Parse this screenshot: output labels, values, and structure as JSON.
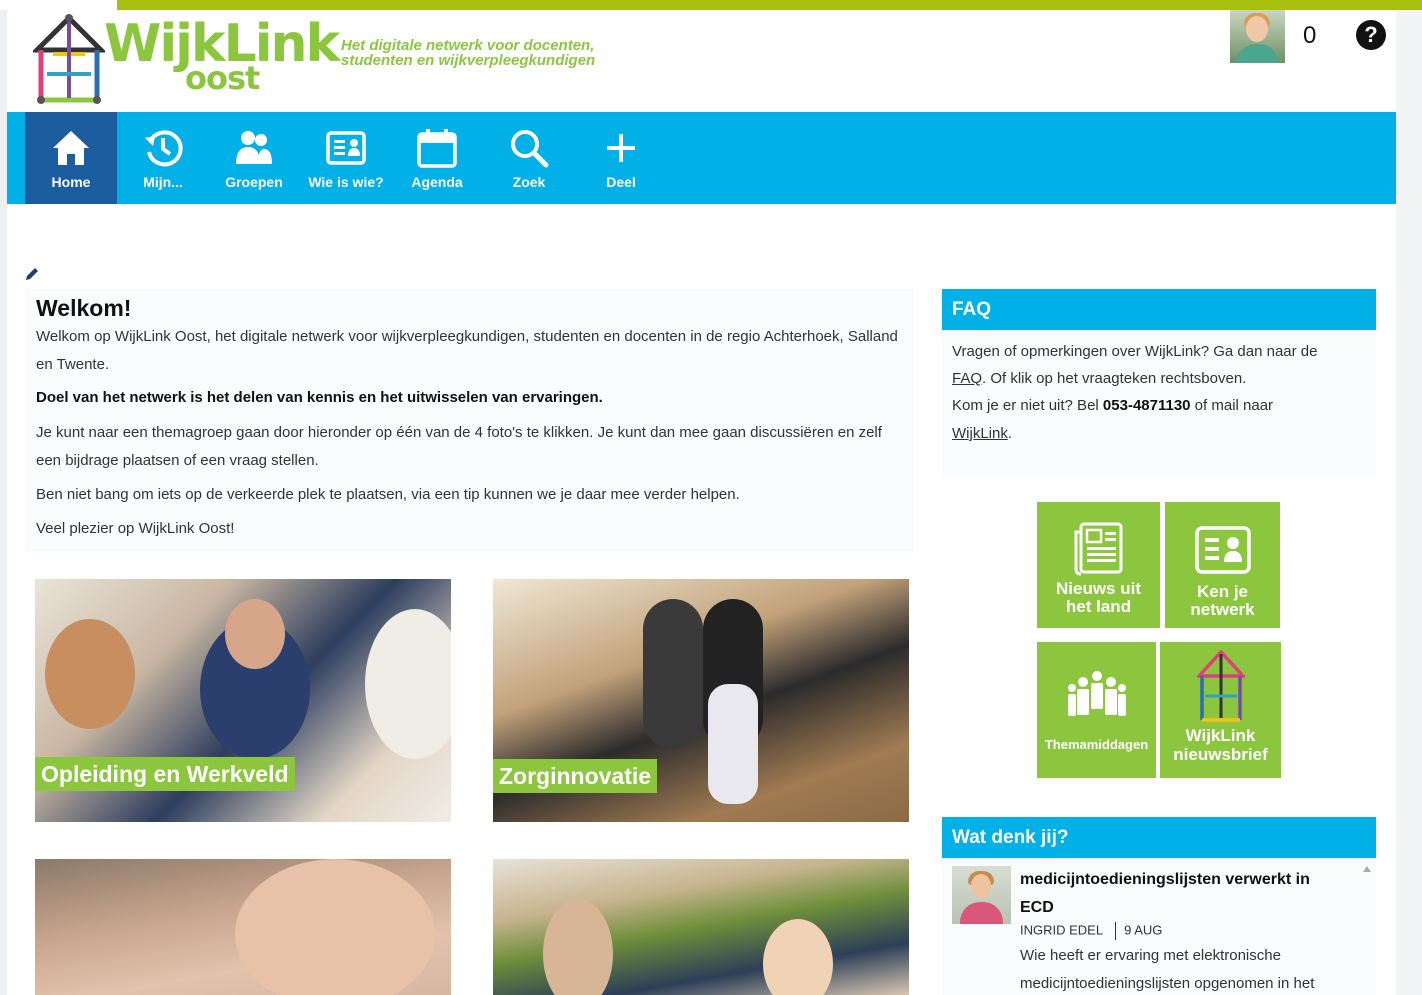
{
  "header": {
    "logo_word": "WijkLink",
    "logo_sub": "oost",
    "tagline_line1": "Het digitale netwerk voor docenten,",
    "tagline_line2": "studenten en wijkverpleegkundigen",
    "notification_count": "0",
    "help_glyph": "?"
  },
  "nav": {
    "items": [
      {
        "label": "Home",
        "icon": "home-icon"
      },
      {
        "label": "Mijn...",
        "icon": "history-icon"
      },
      {
        "label": "Groepen",
        "icon": "group-icon"
      },
      {
        "label": "Wie is wie?",
        "icon": "id-card-icon"
      },
      {
        "label": "Agenda",
        "icon": "calendar-icon"
      },
      {
        "label": "Zoek",
        "icon": "search-icon"
      },
      {
        "label": "Deel",
        "icon": "plus-icon"
      }
    ],
    "active": "Home"
  },
  "welcome": {
    "title": "Welkom!",
    "p1": "Welkom op WijkLink Oost, het digitale netwerk voor wijkverpleegkundigen, studenten en docenten in de regio Achterhoek, Salland en Twente.",
    "p2": "Doel van het netwerk is het delen van kennis en het uitwisselen van ervaringen.",
    "p3": "Je kunt naar een themagroep gaan door hieronder op één van de 4 foto's te klikken. Je kunt dan mee gaan discussiëren en zelf een bijdrage plaatsen of een vraag stellen.",
    "p4": "Ben niet bang om iets op de verkeerde plek te plaatsen, via een tip kunnen we je daar mee verder helpen.",
    "p5": "Veel plezier op WijkLink Oost!"
  },
  "tiles": [
    {
      "label": "Opleiding en Werkveld"
    },
    {
      "label": "Zorginnovatie"
    }
  ],
  "faq": {
    "title": "FAQ",
    "line1": "Vragen of opmerkingen over WijkLink? Ga dan naar de",
    "faq_link": "FAQ",
    "line2_rest": ". Of klik op het vraagteken rechtsboven.",
    "line3_pre": "Kom je er niet uit? Bel ",
    "phone": "053-4871130",
    "line3_post": " of mail naar",
    "mail_link": "WijkLink",
    "line4_rest": "."
  },
  "quicklinks": [
    {
      "line1": "Nieuws uit",
      "line2": "het land",
      "icon": "newspaper-icon"
    },
    {
      "line1": "Ken je",
      "line2": "netwerk",
      "icon": "id-card-icon"
    },
    {
      "line1": "Themamiddagen",
      "icon": "people-icon"
    },
    {
      "line1": "WijkLink",
      "line2": "nieuwsbrief",
      "icon": "wijklink-logo-icon"
    }
  ],
  "wat_denk_jij": {
    "title": "Wat denk jij?",
    "post_title": "medicijntoedieningslijsten verwerkt in ECD",
    "author": "INGRID EDEL",
    "date": "9 AUG",
    "excerpt": "Wie heeft er ervaring met elektronische medicijntoedieningslijsten opgenomen in het"
  },
  "colors": {
    "brand_green": "#8cc63f",
    "lime_strip": "#a8c110",
    "nav_blue": "#00b0e6",
    "nav_active": "#1c5d9f"
  }
}
